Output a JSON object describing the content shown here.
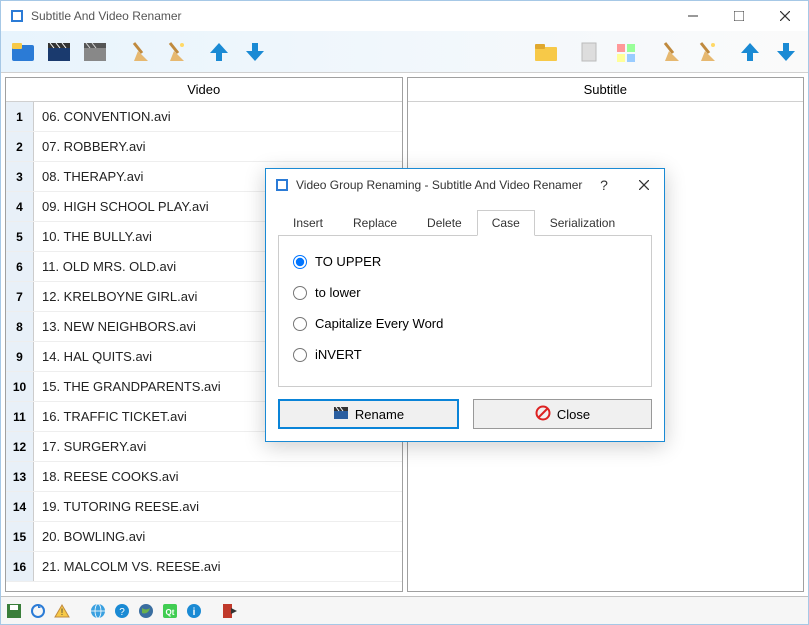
{
  "window": {
    "title": "Subtitle And Video Renamer"
  },
  "panels": {
    "video_header": "Video",
    "subtitle_header": "Subtitle"
  },
  "video_rows": [
    {
      "n": "1",
      "name": "06. CONVENTION.avi"
    },
    {
      "n": "2",
      "name": "07. ROBBERY.avi"
    },
    {
      "n": "3",
      "name": "08. THERAPY.avi"
    },
    {
      "n": "4",
      "name": "09. HIGH SCHOOL PLAY.avi"
    },
    {
      "n": "5",
      "name": "10. THE BULLY.avi"
    },
    {
      "n": "6",
      "name": "11. OLD MRS. OLD.avi"
    },
    {
      "n": "7",
      "name": "12. KRELBOYNE GIRL.avi"
    },
    {
      "n": "8",
      "name": "13. NEW NEIGHBORS.avi"
    },
    {
      "n": "9",
      "name": "14. HAL QUITS.avi"
    },
    {
      "n": "10",
      "name": "15. THE GRANDPARENTS.avi"
    },
    {
      "n": "11",
      "name": "16. TRAFFIC TICKET.avi"
    },
    {
      "n": "12",
      "name": "17. SURGERY.avi"
    },
    {
      "n": "13",
      "name": "18. REESE COOKS.avi"
    },
    {
      "n": "14",
      "name": "19. TUTORING REESE.avi"
    },
    {
      "n": "15",
      "name": "20. BOWLING.avi"
    },
    {
      "n": "16",
      "name": "21. MALCOLM VS. REESE.avi"
    }
  ],
  "dialog": {
    "title": "Video Group Renaming - Subtitle And Video Renamer",
    "tabs": {
      "insert": "Insert",
      "replace": "Replace",
      "delete": "Delete",
      "case": "Case",
      "serialization": "Serialization"
    },
    "case_options": {
      "upper": "TO UPPER",
      "lower": "to lower",
      "capitalize": "Capitalize Every Word",
      "invert": "iNVERT"
    },
    "buttons": {
      "rename": "Rename",
      "close": "Close"
    }
  }
}
